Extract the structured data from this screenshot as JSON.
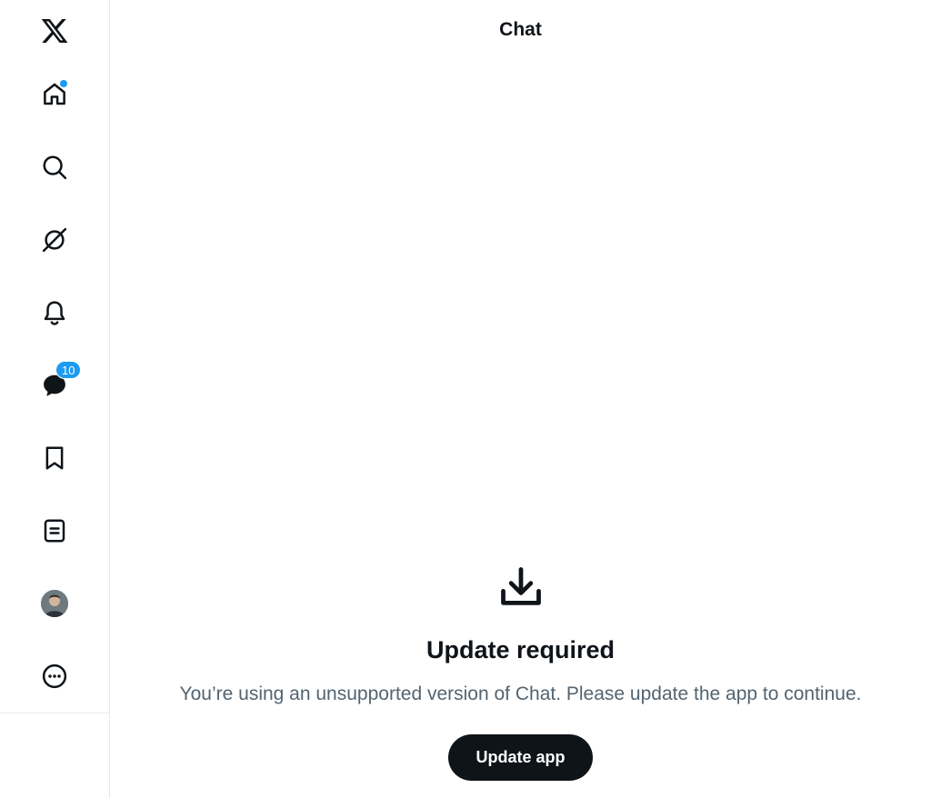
{
  "sidebar": {
    "items": [
      {
        "icon": "x-logo-icon"
      },
      {
        "icon": "home-icon",
        "has_dot": true
      },
      {
        "icon": "search-icon"
      },
      {
        "icon": "grok-icon"
      },
      {
        "icon": "bell-icon"
      },
      {
        "icon": "chat-icon",
        "badge": "10"
      },
      {
        "icon": "bookmark-icon"
      },
      {
        "icon": "lists-icon"
      },
      {
        "icon": "avatar"
      },
      {
        "icon": "more-icon"
      }
    ]
  },
  "header": {
    "title": "Chat"
  },
  "empty_state": {
    "icon": "download-icon",
    "title": "Update required",
    "description": "You’re using an unsupported version of Chat. Please update the app to continue.",
    "button_label": "Update app"
  },
  "colors": {
    "accent": "#1d9bf0",
    "text_primary": "#0f1419",
    "text_secondary": "#536471",
    "button_bg": "#0f1419",
    "border": "#e6e9ec"
  }
}
